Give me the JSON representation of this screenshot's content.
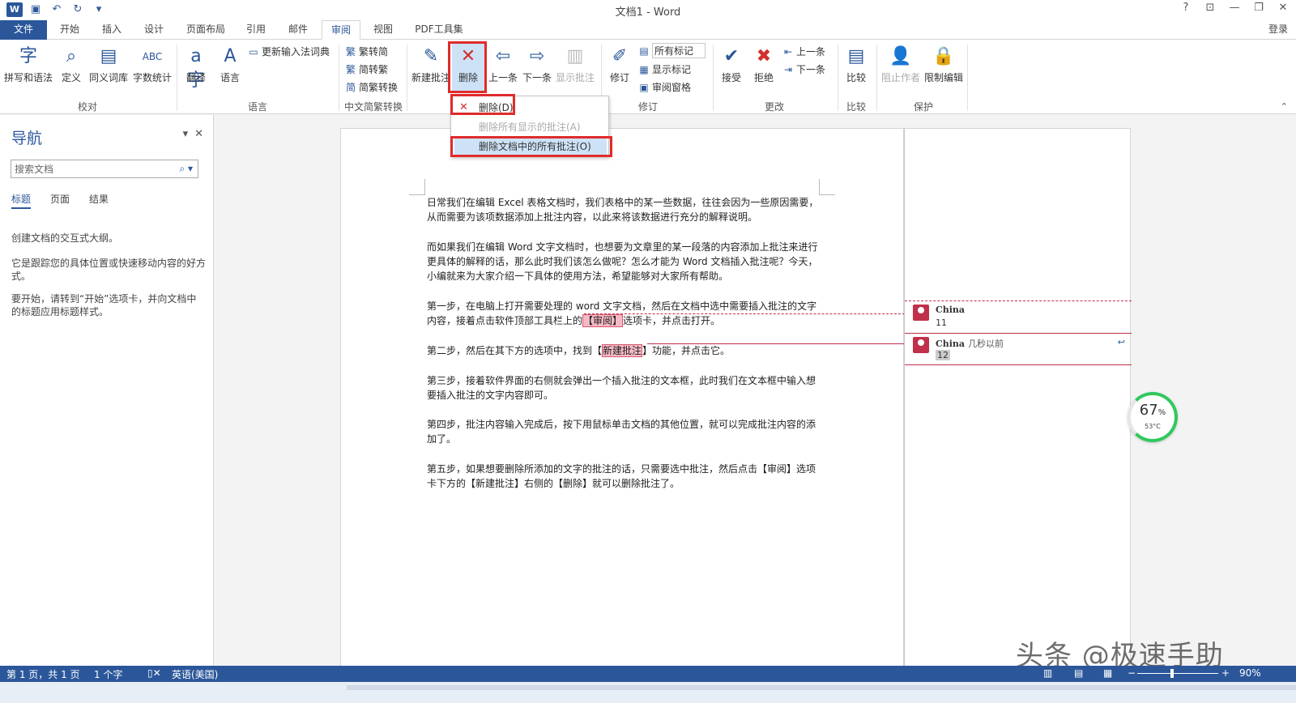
{
  "titlebar": {
    "title": "文档1 - Word",
    "controls": [
      "?",
      "⊡",
      "—",
      "❐",
      "✕"
    ]
  },
  "tabs": [
    {
      "label": "文件"
    },
    {
      "label": "开始"
    },
    {
      "label": "插入"
    },
    {
      "label": "设计"
    },
    {
      "label": "页面布局"
    },
    {
      "label": "引用"
    },
    {
      "label": "邮件"
    },
    {
      "label": "审阅"
    },
    {
      "label": "视图"
    },
    {
      "label": "PDF工具集"
    }
  ],
  "login": "登录",
  "ribbon": {
    "proof": {
      "spelling": "拼写和语法",
      "define": "定义",
      "thesaurus": "同义词库",
      "wordcount": "字数统计",
      "group": "校对"
    },
    "language": {
      "translate": "翻译",
      "language": "语言",
      "update_ime": "更新输入法词典",
      "group": "语言"
    },
    "chinese": {
      "to_simplified": "繁转简",
      "to_traditional": "简转繁",
      "convert": "简繁转换",
      "group": "中文简繁转换"
    },
    "comments": {
      "new": "新建批注",
      "delete": "删除",
      "prev": "上一条",
      "next": "下一条",
      "show": "显示批注"
    },
    "tracking": {
      "track": "修订",
      "markup": "所有标记",
      "show_markup": "显示标记",
      "pane": "审阅窗格",
      "group": "修订"
    },
    "changes": {
      "accept": "接受",
      "reject": "拒绝",
      "prev": "上一条",
      "next": "下一条",
      "group": "更改"
    },
    "compare": {
      "compare": "比较",
      "group": "比较"
    },
    "protect": {
      "block": "阻止作者",
      "restrict": "限制编辑",
      "group": "保护"
    }
  },
  "dropdown": {
    "items": [
      {
        "label": "删除(D)"
      },
      {
        "label": "删除所有显示的批注(A)"
      },
      {
        "label": "删除文档中的所有批注(O)"
      }
    ]
  },
  "nav": {
    "title": "导航",
    "search_placeholder": "搜索文档",
    "tabs": [
      "标题",
      "页面",
      "结果"
    ],
    "text1": "创建文档的交互式大纲。",
    "text2": "它是跟踪您的具体位置或快速移动内容的好方式。",
    "text3": "要开始，请转到“开始”选项卡，并向文档中的标题应用标题样式。"
  },
  "doc": {
    "p1": "日常我们在编辑 Excel 表格文档时，我们表格中的某一些数据，往往会因为一些原因需要，从而需要为该项数据添加上批注内容，以此来将该数据进行充分的解释说明。",
    "p2": "而如果我们在编辑 Word 文字文档时，也想要为文章里的某一段落的内容添加上批注来进行更具体的解释的话，那么此时我们该怎么做呢？怎么才能为 Word 文档插入批注呢？今天，小编就来为大家介绍一下具体的使用方法，希望能够对大家所有帮助。",
    "p3_a": "第一步，在电脑上打开需要处理的 word 文字文档，然后在文档中选中需要插入批注的文字内容，接着点击软件顶部工具栏上的",
    "p3_b": "【审阅】",
    "p3_c": "选项卡，并点击打开。",
    "p4_a": "第二步，然后在其下方的选项中，找到【",
    "p4_b": "新建批注",
    "p4_c": "】功能，并点击它。",
    "p5": "第三步，接着软件界面的右侧就会弹出一个插入批注的文本框，此时我们在文本框中输入想要插入批注的文字内容即可。",
    "p6": "第四步，批注内容输入完成后，按下用鼠标单击文档的其他位置，就可以完成批注内容的添加了。",
    "p7": "第五步，如果想要删除所添加的文字的批注的话，只需要选中批注，然后点击【审阅】选项卡下方的【新建批注】右侧的【删除】就可以删除批注了。"
  },
  "comments": [
    {
      "author": "China",
      "time": "",
      "text": "11"
    },
    {
      "author": "China",
      "time": "几秒以前",
      "text": "12"
    }
  ],
  "gauge": {
    "percent": "67",
    "unit": "%",
    "temp": "53°C"
  },
  "watermark": "头条 @极速手助",
  "status": {
    "page": "第 1 页，共 1 页",
    "words": "1 个字",
    "lang": "英语(美国)",
    "zoom": "90%"
  }
}
